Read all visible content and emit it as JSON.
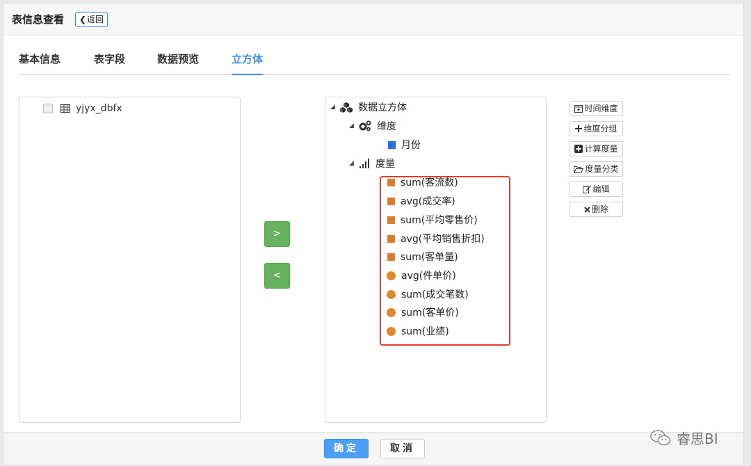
{
  "header": {
    "title": "表信息查看",
    "back_label": "返回"
  },
  "tabs": [
    {
      "label": "基本信息"
    },
    {
      "label": "表字段"
    },
    {
      "label": "数据预览"
    },
    {
      "label": "立方体"
    }
  ],
  "source": {
    "table_name": "yjyx_dbfx"
  },
  "cube": {
    "root_label": "数据立方体",
    "dimension_group": "维度",
    "dimensions": [
      {
        "label": "月份",
        "color": "#2a6ed8"
      }
    ],
    "measure_group": "度量",
    "measures": [
      {
        "label": "sum(客流数)",
        "shape": "square",
        "color": "#e07b29"
      },
      {
        "label": "avg(成交率)",
        "shape": "square",
        "color": "#e07b29"
      },
      {
        "label": "sum(平均零售价)",
        "shape": "square",
        "color": "#e07b29"
      },
      {
        "label": "avg(平均销售折扣)",
        "shape": "square",
        "color": "#e07b29"
      },
      {
        "label": "sum(客单量)",
        "shape": "square",
        "color": "#e07b29"
      },
      {
        "label": "avg(件单价)",
        "shape": "circle",
        "color": "#e08a2f"
      },
      {
        "label": "sum(成交笔数)",
        "shape": "circle",
        "color": "#e08a2f"
      },
      {
        "label": "sum(客单价)",
        "shape": "circle",
        "color": "#e08a2f"
      },
      {
        "label": "sum(业绩)",
        "shape": "circle",
        "color": "#e08a2f"
      }
    ]
  },
  "transfer": {
    "add_label": ">",
    "remove_label": "<"
  },
  "actions": {
    "time_dimension": "时间维度",
    "dimension_group": "维度分组",
    "calc_measure": "计算度量",
    "measure_category": "度量分类",
    "edit": "编辑",
    "delete": "删除"
  },
  "footer": {
    "confirm": "确定",
    "cancel": "取消"
  },
  "watermark": "睿思BI",
  "colors": {
    "accent": "#3a8ee6",
    "green": "#67b25c",
    "highlight": "#e53a2c"
  }
}
